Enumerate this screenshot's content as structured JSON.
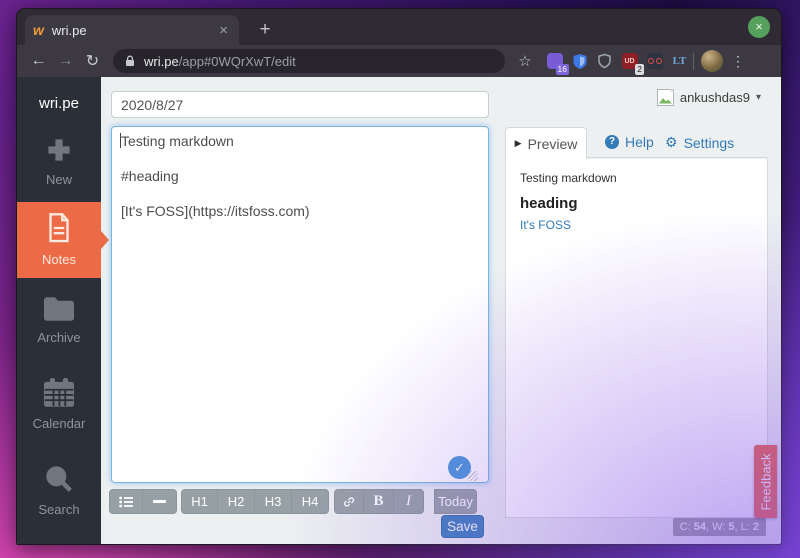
{
  "icons": {
    "favicon": "w",
    "back": "←",
    "forward": "→",
    "reload": "↻",
    "star": "☆",
    "menu": "⋮",
    "window_close": "×",
    "tab_close": "×",
    "new_tab": "+",
    "caret_down": "▾",
    "play": "▶",
    "help_glyph": "?",
    "gear": "⚙",
    "check": "✓",
    "lt_label": "LT",
    "ublock_label": "UD"
  },
  "browser": {
    "tab_title": "wri.pe",
    "url_domain": "wri.pe",
    "url_path": "/app#0WQrXwT/edit",
    "extensions": {
      "purple_badge": "16",
      "red_badge": "2"
    }
  },
  "app": {
    "logo": "wri.pe",
    "sidebar": {
      "items": [
        {
          "label": "New"
        },
        {
          "label": "Notes"
        },
        {
          "label": "Archive"
        },
        {
          "label": "Calendar"
        },
        {
          "label": "Search"
        }
      ]
    },
    "editor": {
      "title_value": "2020/8/27",
      "body_value": "Testing markdown\n\n#heading\n\n[It's FOSS](https://itsfoss.com)",
      "toolbar": {
        "h1": "H1",
        "h2": "H2",
        "h3": "H3",
        "h4": "H4",
        "bold": "B",
        "italic": "I",
        "today": "Today",
        "save": "Save"
      }
    },
    "user": {
      "name": "ankushdas9"
    },
    "panel": {
      "tabs": {
        "preview": "Preview",
        "help": "Help",
        "settings": "Settings"
      },
      "preview": {
        "paragraph": "Testing markdown",
        "heading": "heading",
        "link": "It's FOSS"
      }
    },
    "status": {
      "c_label": "C:",
      "c_value": " 54",
      "w_label": ", W:",
      "w_value": " 5",
      "l_label": ", L:",
      "l_value": " 2"
    },
    "feedback_label": "Feedback"
  },
  "colors": {
    "accent_orange": "#ec6a45",
    "save_blue": "#3e81bb",
    "link_blue": "#337ab7",
    "feedback_orange": "#ed6547",
    "focus_ring": "#74b3dd",
    "sidebar_bg": "#2a2f38",
    "page_bg": "#edf0f1"
  }
}
